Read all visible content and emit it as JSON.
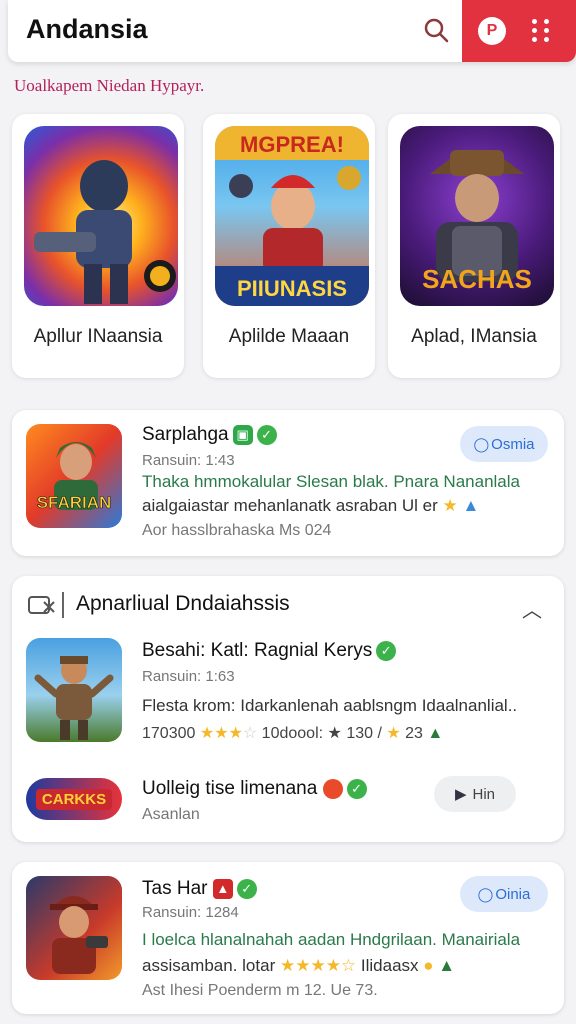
{
  "header": {
    "title": "Andansia",
    "icons": {
      "search": "search-icon",
      "profile": "profile-icon",
      "menu": "more-vert-icon"
    },
    "accent_color": "#e2323f"
  },
  "section_label": "Uoalkapem Niedan Hypayr.",
  "featured": [
    {
      "name": "Apllur INaansia",
      "art_text": ""
    },
    {
      "name": "Aplilde Maaan",
      "art_text_top": "MGPREA!",
      "art_text_bottom": "PIIUNASIS"
    },
    {
      "name": "Aplad, IMansia",
      "art_text": "SACHAS"
    }
  ],
  "list1": {
    "icon_text": "SFARIAN",
    "title": "Sarplahga",
    "sub": "Ransuin: 1:43",
    "desc_line1": "Thaka hmmokalular Slesan blak. Pnara Nananlala",
    "desc_line2": "aialgaiastar mehanlanatk asraban Ul er",
    "desc_line3": "Aor hasslbrahaska Ms 024",
    "button": "Osmia"
  },
  "group": {
    "title": "Apnarliual Dndaiahssis",
    "items": [
      {
        "title": "Besahi: Katl: Ragnial Kerys",
        "sub": "Ransuin: 1:63",
        "desc": "Flesta krom: Idarkanlenah aablsngm Idaalnanlial..",
        "stats": "170300",
        "rating_text": "10doool:",
        "count1": "130",
        "count2": "23"
      },
      {
        "icon_text": "CARKKS",
        "title": "Uolleig tise limenana",
        "sub": "Asanlan",
        "button": "Hin"
      }
    ]
  },
  "list2": {
    "title": "Tas Har",
    "sub": "Ransuin: 1284",
    "desc_line1": "I loelca hlanalnahah aadan Hndgrilaan. Manairiala",
    "desc_line2": "assisamban. lotar",
    "desc_line2b": "Ilidaasx",
    "desc_line3": "Ast Ihesi Poenderm m 12. Ue 73.",
    "button": "Oinia"
  }
}
